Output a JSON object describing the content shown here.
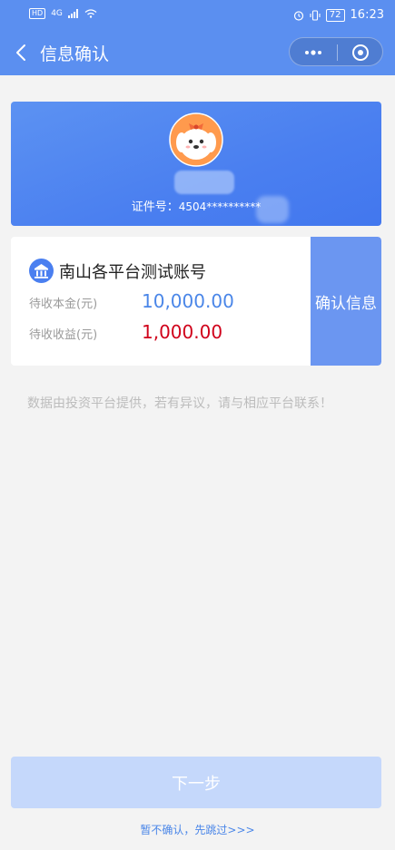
{
  "status_bar": {
    "hd": "HD",
    "network": "4G",
    "battery": "72",
    "time": "16:23"
  },
  "nav": {
    "title": "信息确认",
    "icons": [
      "back-icon",
      "more-icon",
      "target-icon"
    ]
  },
  "hero": {
    "id_label": "证件号：",
    "id_value": "4504**********"
  },
  "account": {
    "icon": "bank-icon",
    "name": "南山各平台测试账号",
    "principal_label": "待收本金(元)",
    "principal_value": "10,000.00",
    "income_label": "待收收益(元)",
    "income_value": "1,000.00",
    "confirm_label": "确认信息"
  },
  "notice": "数据由投资平台提供，若有异议，请与相应平台联系！",
  "footer": {
    "next_label": "下一步",
    "skip_label": "暂不确认，先跳过>>>"
  },
  "colors": {
    "primary": "#5b8ff0",
    "principal": "#4a86e8",
    "income": "#d0021b",
    "next_disabled": "#c5d8fb"
  }
}
